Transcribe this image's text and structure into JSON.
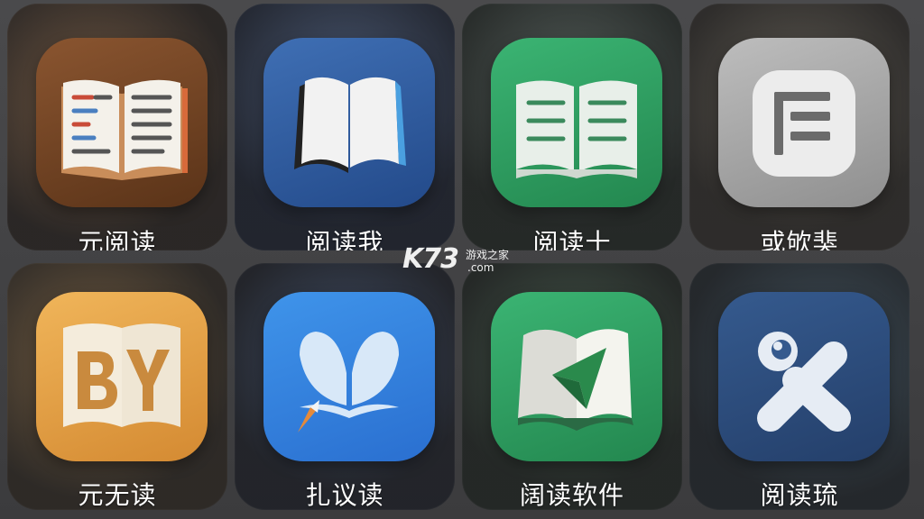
{
  "apps": [
    {
      "name": "元阅读",
      "icon": "open-book-icon",
      "color": "#7a4a26"
    },
    {
      "name": "阅读我",
      "icon": "open-book-icon",
      "color": "#2f5a9c"
    },
    {
      "name": "阅读十",
      "icon": "open-book-icon",
      "color": "#2e9c62"
    },
    {
      "name": "或欨猆",
      "icon": "document-lines-icon",
      "color": "#a8a8a8"
    },
    {
      "name": "元无读",
      "icon": "by-book-icon",
      "color": "#e0a04a"
    },
    {
      "name": "扎议读",
      "icon": "leaf-quill-icon",
      "color": "#2f7fe0"
    },
    {
      "name": "阔读软件",
      "icon": "book-navigation-icon",
      "color": "#2e9c62"
    },
    {
      "name": "阅读琉",
      "icon": "x-swirl-icon",
      "color": "#2d4a7a"
    }
  ],
  "watermark": {
    "main": "K73",
    "sub_top": "游戏之家",
    "sub_bottom": ".com"
  }
}
